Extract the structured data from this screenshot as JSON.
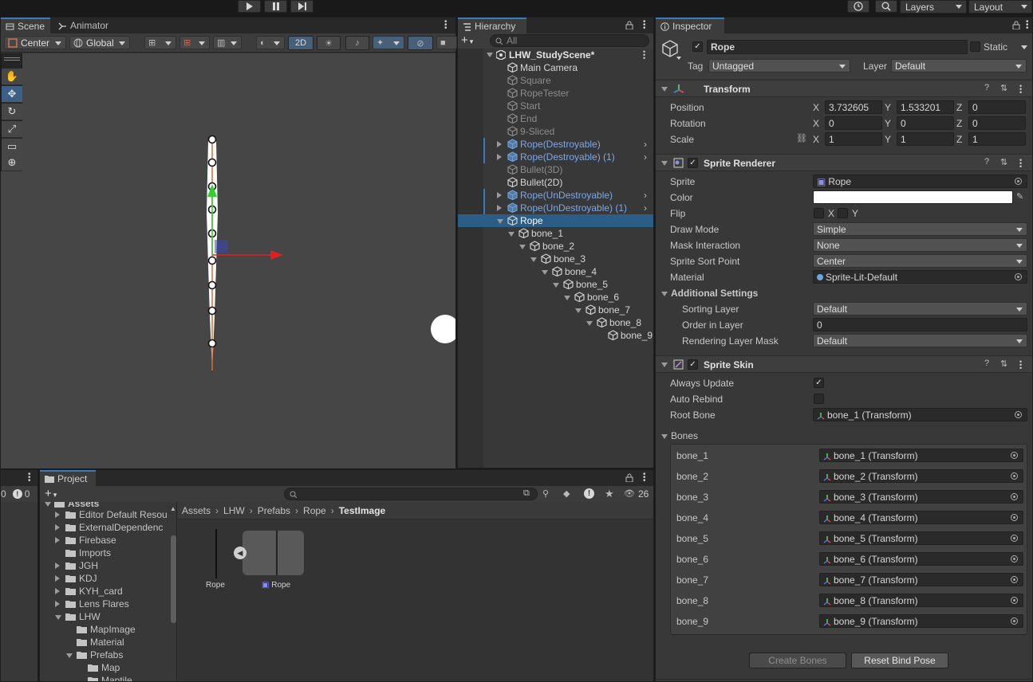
{
  "toolbar": {
    "layers_label": "Layers",
    "layout_label": "Layout"
  },
  "scene": {
    "tabs": [
      "Scene",
      "Animator"
    ],
    "pivot_label": "Center",
    "space_label": "Global",
    "mode_2d_label": "2D"
  },
  "hierarchy": {
    "tab_label": "Hierarchy",
    "search_placeholder": "All",
    "scene_name": "LHW_StudyScene*",
    "items": [
      {
        "label": "Main Camera",
        "style": "normal"
      },
      {
        "label": "Square",
        "style": "disabled"
      },
      {
        "label": "RopeTester",
        "style": "disabled"
      },
      {
        "label": "Start",
        "style": "disabled"
      },
      {
        "label": "End",
        "style": "disabled"
      },
      {
        "label": "9-Sliced",
        "style": "disabled"
      },
      {
        "label": "Rope(Destroyable)",
        "style": "prefab"
      },
      {
        "label": "Rope(Destroyable) (1)",
        "style": "prefab"
      },
      {
        "label": "Bullet(3D)",
        "style": "disabled"
      },
      {
        "label": "Bullet(2D)",
        "style": "normal"
      },
      {
        "label": "Rope(UnDestroyable)",
        "style": "prefab"
      },
      {
        "label": "Rope(UnDestroyable) (1)",
        "style": "prefab"
      },
      {
        "label": "Rope",
        "style": "selected"
      },
      {
        "label": "bone_1",
        "style": "normal"
      },
      {
        "label": "bone_2",
        "style": "normal"
      },
      {
        "label": "bone_3",
        "style": "normal"
      },
      {
        "label": "bone_4",
        "style": "normal"
      },
      {
        "label": "bone_5",
        "style": "normal"
      },
      {
        "label": "bone_6",
        "style": "normal"
      },
      {
        "label": "bone_7",
        "style": "normal"
      },
      {
        "label": "bone_8",
        "style": "normal"
      },
      {
        "label": "bone_9",
        "style": "normal"
      }
    ]
  },
  "project": {
    "tab_label": "Project",
    "console_counts": [
      "0",
      "0"
    ],
    "hidden_count": "26",
    "breadcrumb": [
      "Assets",
      "LHW",
      "Prefabs",
      "Rope",
      "TestImage"
    ],
    "tree_root": "Assets",
    "tree": [
      "Editor Default Resou",
      "ExternalDependenc",
      "Firebase",
      "Imports",
      "JGH",
      "KDJ",
      "KYH_card",
      "Lens Flares",
      "LHW",
      "MapImage",
      "Material",
      "Prefabs",
      "Map",
      "Maptile"
    ],
    "assets": [
      "Rope",
      "Rope"
    ]
  },
  "inspector": {
    "tab_label": "Inspector",
    "object_name": "Rope",
    "static_label": "Static",
    "tag_label": "Tag",
    "tag_value": "Untagged",
    "layer_label": "Layer",
    "layer_value": "Default",
    "transform": {
      "title": "Transform",
      "position_label": "Position",
      "rotation_label": "Rotation",
      "scale_label": "Scale",
      "position": {
        "x": "3.732605",
        "y": "1.533201",
        "z": "0"
      },
      "rotation": {
        "x": "0",
        "y": "0",
        "z": "0"
      },
      "scale": {
        "x": "1",
        "y": "1",
        "z": "1"
      }
    },
    "sprite_renderer": {
      "title": "Sprite Renderer",
      "sprite_label": "Sprite",
      "sprite_value": "Rope",
      "color_label": "Color",
      "color_value": "#ffffff",
      "flip_label": "Flip",
      "flip_x": "X",
      "flip_y": "Y",
      "draw_mode_label": "Draw Mode",
      "draw_mode_value": "Simple",
      "mask_label": "Mask Interaction",
      "mask_value": "None",
      "sort_point_label": "Sprite Sort Point",
      "sort_point_value": "Center",
      "material_label": "Material",
      "material_value": "Sprite-Lit-Default",
      "additional_label": "Additional Settings",
      "sorting_layer_label": "Sorting Layer",
      "sorting_layer_value": "Default",
      "order_label": "Order in Layer",
      "order_value": "0",
      "rendering_mask_label": "Rendering Layer Mask",
      "rendering_mask_value": "Default"
    },
    "sprite_skin": {
      "title": "Sprite Skin",
      "always_update_label": "Always Update",
      "auto_rebind_label": "Auto Rebind",
      "root_bone_label": "Root Bone",
      "root_bone_value": "bone_1 (Transform)",
      "bones_label": "Bones",
      "bones": [
        {
          "name": "bone_1",
          "ref": "bone_1 (Transform)"
        },
        {
          "name": "bone_2",
          "ref": "bone_2 (Transform)"
        },
        {
          "name": "bone_3",
          "ref": "bone_3 (Transform)"
        },
        {
          "name": "bone_4",
          "ref": "bone_4 (Transform)"
        },
        {
          "name": "bone_5",
          "ref": "bone_5 (Transform)"
        },
        {
          "name": "bone_6",
          "ref": "bone_6 (Transform)"
        },
        {
          "name": "bone_7",
          "ref": "bone_7 (Transform)"
        },
        {
          "name": "bone_8",
          "ref": "bone_8 (Transform)"
        },
        {
          "name": "bone_9",
          "ref": "bone_9 (Transform)"
        }
      ],
      "create_bones_label": "Create Bones",
      "reset_bind_label": "Reset Bind Pose"
    }
  },
  "colors": {
    "selection": "#2c5d87",
    "prefab_text": "#7aa8e8",
    "accent_tab": "#3a79bb"
  }
}
